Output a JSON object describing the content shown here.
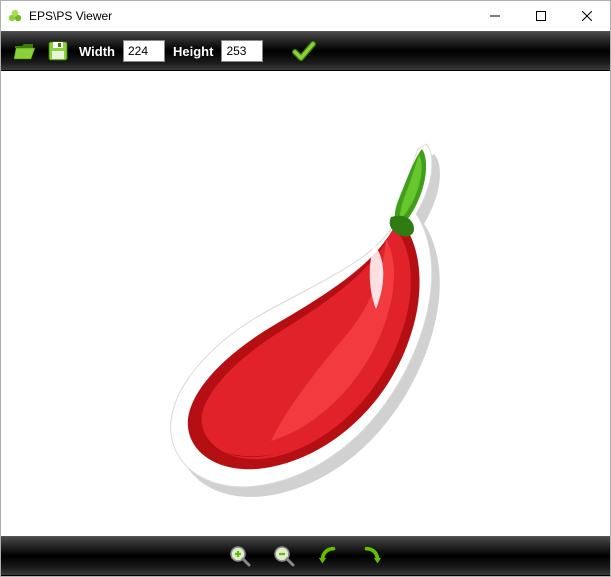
{
  "window": {
    "title": "EPS\\PS Viewer"
  },
  "toolbar": {
    "width_label": "Width",
    "height_label": "Height",
    "width_value": "224",
    "height_value": "253"
  },
  "icons": {
    "open": "open-folder-icon",
    "save": "save-icon",
    "apply": "checkmark-icon",
    "zoom_in": "zoom-in-icon",
    "zoom_out": "zoom-out-icon",
    "rotate_left": "rotate-left-icon",
    "rotate_right": "rotate-right-icon"
  },
  "colors": {
    "accent_green": "#5fbf00",
    "toolbar_bg": "#1a1a1a"
  },
  "content": {
    "description": "red chili pepper sticker illustration"
  }
}
